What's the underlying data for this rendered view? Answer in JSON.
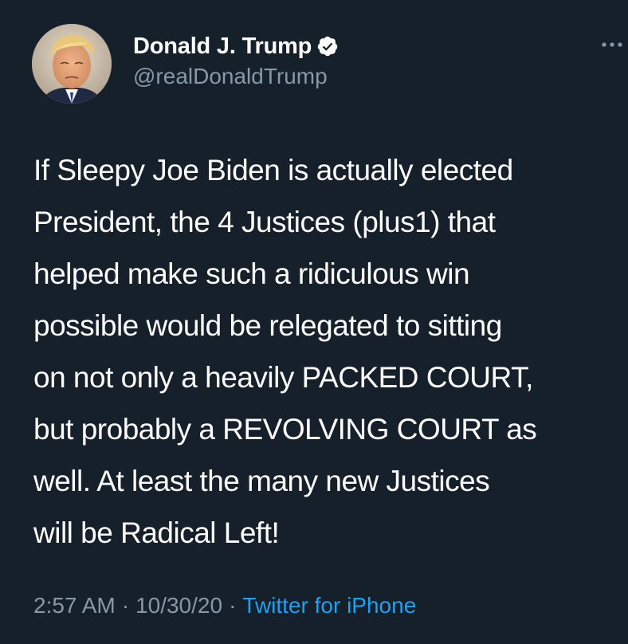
{
  "author": {
    "display_name": "Donald J. Trump",
    "handle": "@realDonaldTrump",
    "verified": true,
    "avatar_icon": "profile-photo"
  },
  "tweet": {
    "text": "If Sleepy Joe Biden is actually elected\nPresident, the 4 Justices (plus1) that\nhelped make such a ridiculous win\npossible would be relegated to sitting\non not only a heavily PACKED COURT,\nbut probably a REVOLVING COURT as\nwell. At least the many new Justices\nwill be Radical Left!",
    "time": "2:57 AM",
    "date": "10/30/20",
    "separator": "·",
    "source": "Twitter for iPhone"
  },
  "icons": {
    "more": "more-options-icon",
    "verified": "verified-badge-icon"
  },
  "colors": {
    "background": "#15202b",
    "text": "#ffffff",
    "secondary_text": "#8899a6",
    "link": "#1da1f2"
  }
}
